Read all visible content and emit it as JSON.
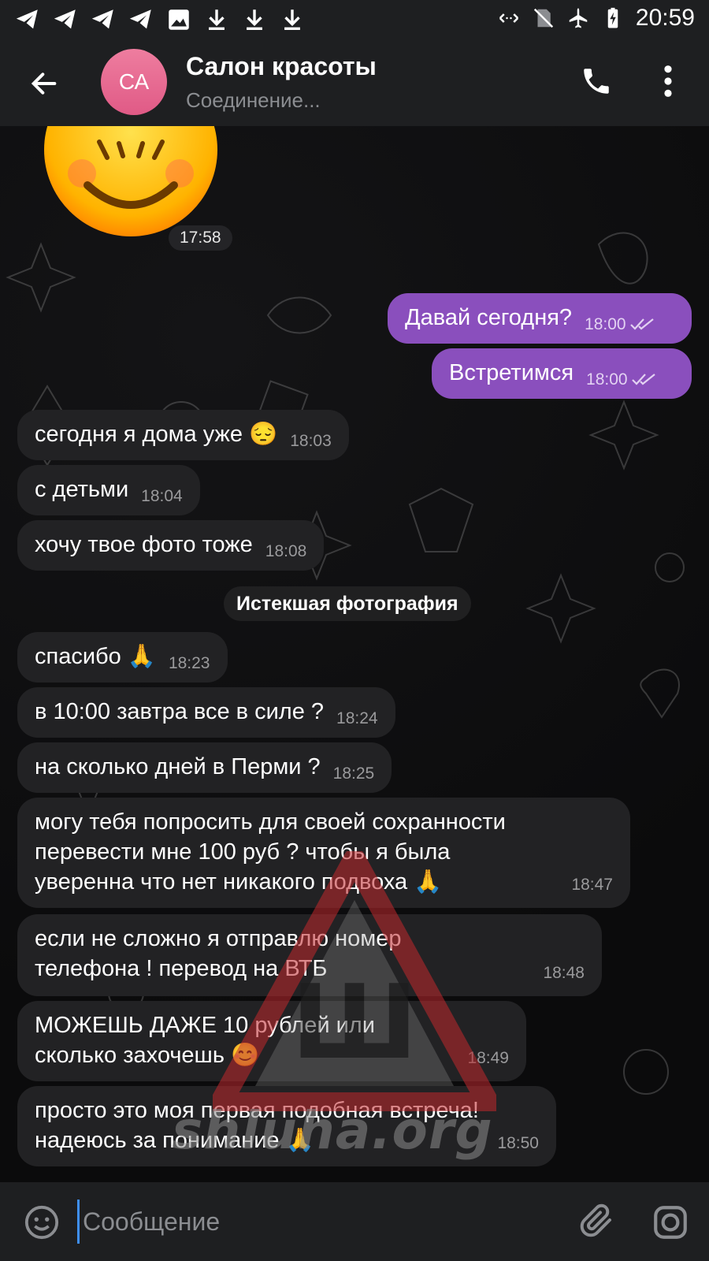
{
  "status_bar": {
    "time": "20:59",
    "left_icons": [
      "telegram-icon",
      "telegram-icon",
      "telegram-icon",
      "telegram-icon",
      "image-icon",
      "download-icon",
      "download-icon",
      "download-icon"
    ],
    "right_icons": [
      "data-saver-icon",
      "no-sim-icon",
      "airplane-icon",
      "battery-charging-icon"
    ]
  },
  "header": {
    "avatar_initials": "СА",
    "title": "Салон красоты",
    "subtitle": "Соединение..."
  },
  "chat": {
    "sticker_time": "17:58",
    "messages": [
      {
        "dir": "out",
        "text": "Давай сегодня?",
        "time": "18:00"
      },
      {
        "dir": "out",
        "text": "Встретимся",
        "time": "18:00"
      },
      {
        "dir": "in",
        "text": "сегодня я дома уже 😔",
        "time": "18:03"
      },
      {
        "dir": "in",
        "text": "с детьми",
        "time": "18:04"
      },
      {
        "dir": "in",
        "text": "хочу твое фото тоже",
        "time": "18:08"
      },
      {
        "dir": "in",
        "text": "спасибо 🙏",
        "time": "18:23"
      },
      {
        "dir": "in",
        "text": "в 10:00 завтра все в силе ?",
        "time": "18:24"
      },
      {
        "dir": "in",
        "text": "на сколько дней в Перми ?",
        "time": "18:25"
      },
      {
        "dir": "in",
        "text": "могу тебя попросить для своей сохранности перевести мне 100 руб ? чтобы я была уверенна что нет никакого подвоха 🙏",
        "time": "18:47"
      },
      {
        "dir": "in",
        "text": "если не сложно я отправлю номер телефона ! перевод на ВТБ",
        "time": "18:48"
      },
      {
        "dir": "in",
        "text": "МОЖЕШЬ ДАЖЕ 10 рублей или сколько захочешь 😊",
        "time": "18:49"
      },
      {
        "dir": "in",
        "text": "просто это моя первая подобная встреча! надеюсь за понимание 🙏",
        "time": "18:50"
      }
    ],
    "service_message": "Истекшая фотография"
  },
  "watermark": {
    "text": "shluha.org",
    "sign_text": "Ш"
  },
  "input": {
    "placeholder": "Сообщение"
  },
  "colors": {
    "outgoing_bubble": "#8a4fbd",
    "incoming_bubble": "#222224",
    "header_bg": "#1e1f21",
    "avatar": "#e86a92"
  }
}
